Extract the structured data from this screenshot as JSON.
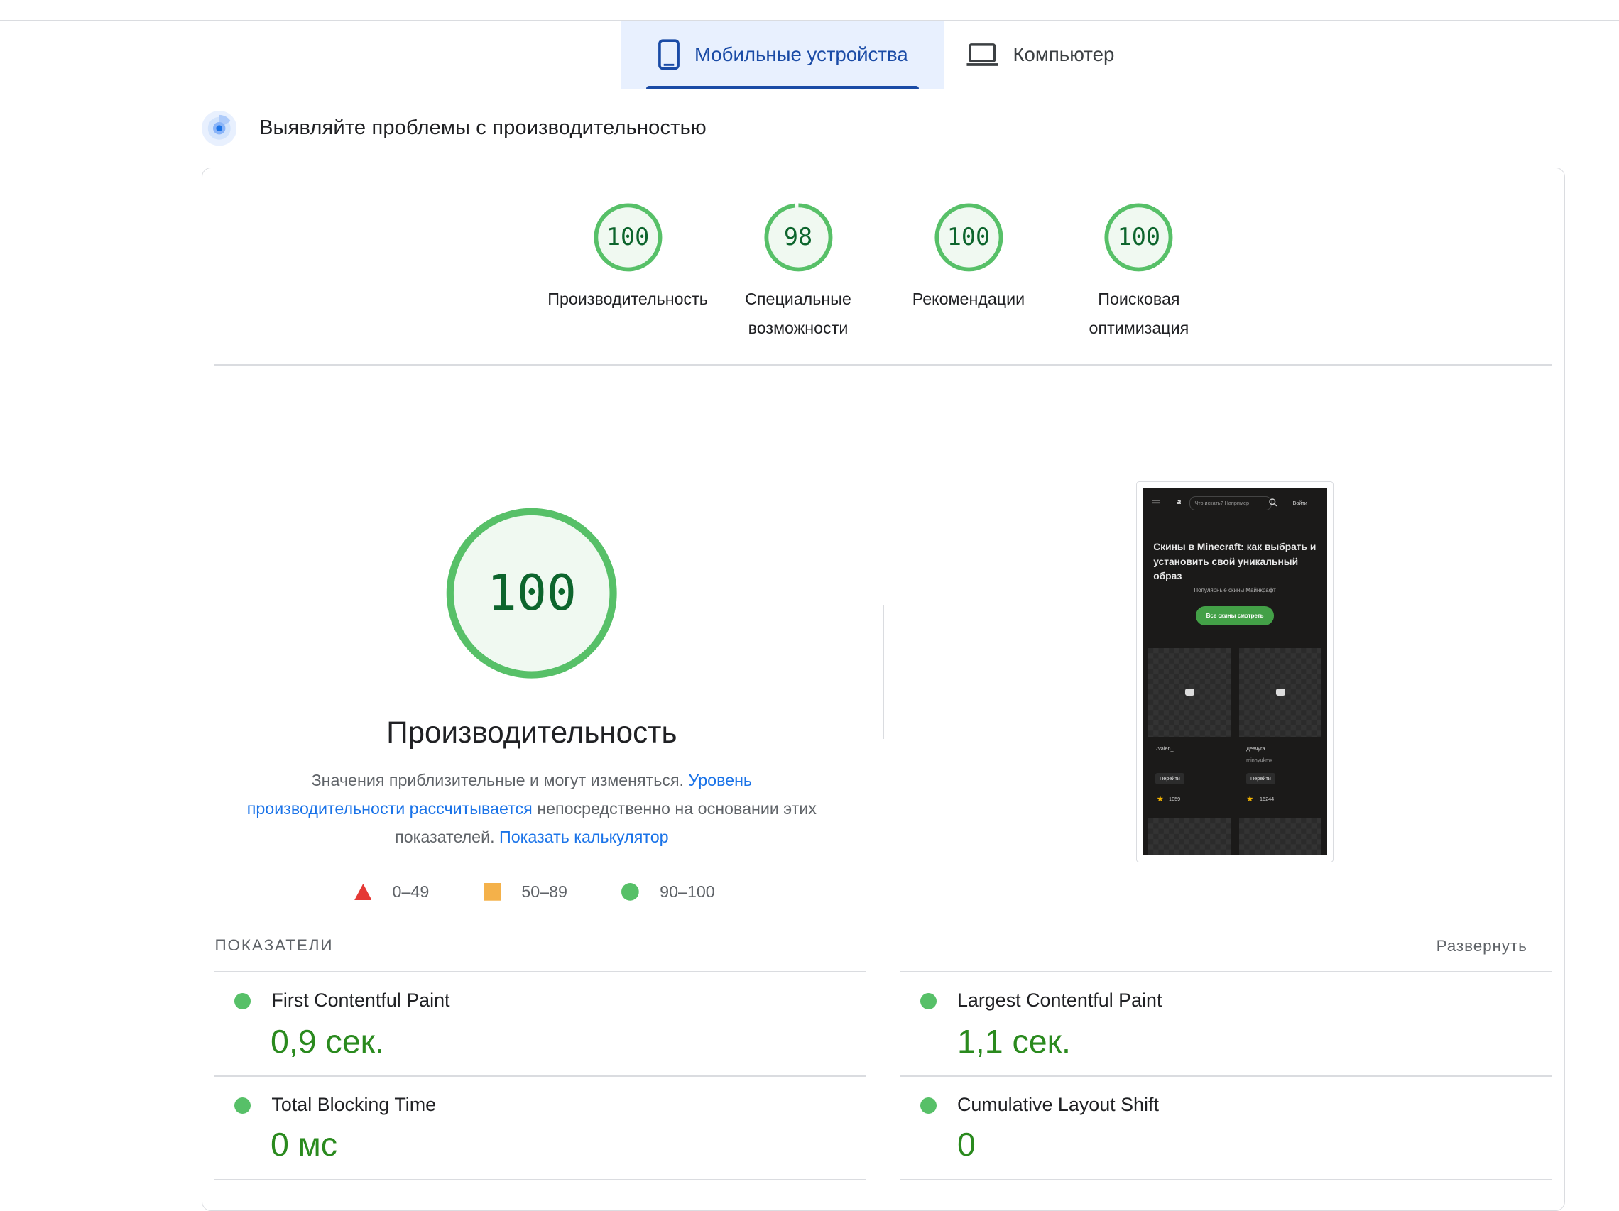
{
  "tabs": {
    "mobile": {
      "label": "Мобильные устройства",
      "icon": "smartphone-icon"
    },
    "desktop": {
      "label": "Компьютер",
      "icon": "laptop-icon"
    }
  },
  "header": {
    "title": "Выявляйте проблемы с производительностью",
    "icon": "lighthouse-radar-icon"
  },
  "categories": [
    {
      "score": "100",
      "label": "Производительность",
      "fraction": 1.0
    },
    {
      "score": "98",
      "label1": "Специальные",
      "label2": "возможности",
      "fraction": 0.98
    },
    {
      "score": "100",
      "label": "Рекомендации",
      "fraction": 1.0
    },
    {
      "score": "100",
      "label1": "Поисковая",
      "label2": "оптимизация",
      "fraction": 1.0
    }
  ],
  "performance": {
    "score": "100",
    "title": "Производительность",
    "desc_1": "Значения приблизительные и могут изменяться. ",
    "desc_link1": "Уровень производительности рассчитывается",
    "desc_2": " непосредственно на основании этих показателей. ",
    "desc_link2": "Показать калькулятор"
  },
  "legend": {
    "red": "0–49",
    "orange": "50–89",
    "green": "90–100"
  },
  "screenshot": {
    "search_placeholder": "Что искать? Например",
    "login": "Войти",
    "title": "Скины в Minecraft: как выбрать и установить свой уникальный образ",
    "subtitle": "Популярные скины Майнкрафт",
    "button": "Все скины смотреть",
    "card1": {
      "name": "7valen_",
      "go": "Перейти",
      "likes": "1059"
    },
    "card2": {
      "name": "Девчуга",
      "author": "minhyukmx",
      "go": "Перейти",
      "likes": "16244"
    }
  },
  "metrics": {
    "heading": "ПОКАЗАТЕЛИ",
    "expand": "Развернуть",
    "fcp": {
      "name": "First Contentful Paint",
      "value": "0,9 сек."
    },
    "lcp": {
      "name": "Largest Contentful Paint",
      "value": "1,1 сек."
    },
    "tbt": {
      "name": "Total Blocking Time",
      "value": "0 мс"
    },
    "cls": {
      "name": "Cumulative Layout Shift",
      "value": "0"
    }
  },
  "colors": {
    "pass": "#57c068",
    "pass_text": "#0d652d",
    "accent": "#1a4ba6",
    "link": "#1a73e8",
    "fail": "#e53935",
    "average": "#f4b14a"
  }
}
